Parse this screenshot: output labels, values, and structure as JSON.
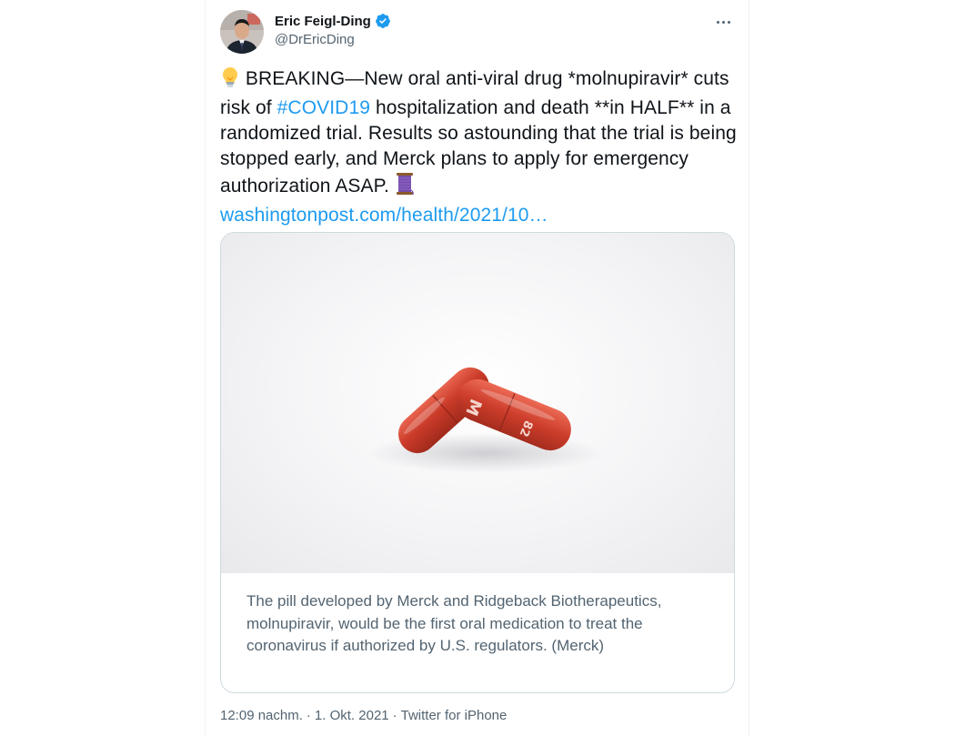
{
  "author": {
    "name": "Eric Feigl-Ding",
    "handle": "@DrEricDing",
    "verified": true
  },
  "tweet": {
    "text_before_hashtag": " BREAKING—New oral anti-viral drug *molnupiravir* cuts risk of ",
    "hashtag": "#COVID19",
    "text_after_hashtag": " hospitalization and death **in HALF** in a randomized trial. Results so astounding that the trial is being stopped early, and Merck plans to apply for emergency authorization ASAP. ",
    "link": "washingtonpost.com/health/2021/10…",
    "emoji_start": "light-bulb-icon",
    "emoji_end": "thread-spool-icon"
  },
  "media": {
    "image_description_icon": "red-capsules-image",
    "caption": "The pill developed by Merck and Ridgeback Biotherapeutics, molnupiravir, would be the first oral medication to treat the coronavirus if authorized by U.S. regulators. (Merck)"
  },
  "meta": {
    "time": "12:09 nachm.",
    "separator1": "·",
    "date": "1. Okt. 2021",
    "separator2": "·",
    "source": "Twitter for iPhone"
  },
  "colors": {
    "link": "#1d9bf0",
    "text": "#0f1419",
    "secondary": "#536471",
    "verified": "#1d9bf0"
  }
}
